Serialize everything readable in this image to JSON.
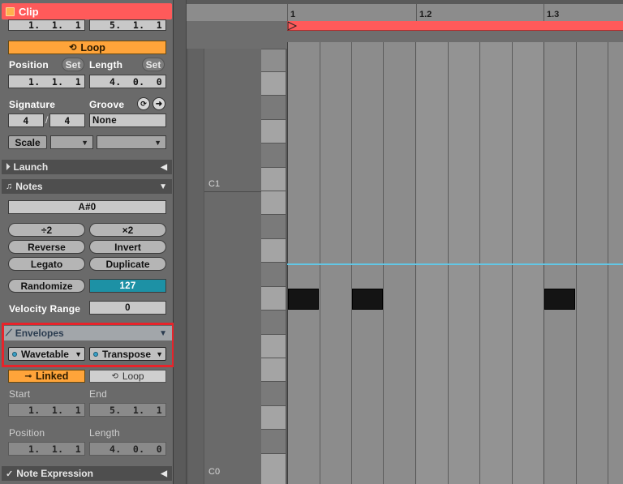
{
  "clip": {
    "title": "Clip",
    "loop_start_field": "1.  1.  1",
    "loop_end_field": "5.  1.  1",
    "loop_button": "Loop",
    "position_label": "Position",
    "set1": "Set",
    "length_label": "Length",
    "set2": "Set",
    "position_value": "1.  1.  1",
    "length_value": "4.  0.  0",
    "signature_label": "Signature",
    "groove_label": "Groove",
    "sig_num": "4",
    "sig_slash": "/",
    "sig_den": "4",
    "groove_value": "None",
    "scale_button": "Scale"
  },
  "launch": {
    "title": "Launch"
  },
  "notes": {
    "title": "Notes",
    "pitch": "A#0",
    "half": "÷2",
    "double": "×2",
    "reverse": "Reverse",
    "invert": "Invert",
    "legato": "Legato",
    "duplicate": "Duplicate",
    "randomize": "Randomize",
    "randomize_value": "127",
    "velocity_range_label": "Velocity Range",
    "velocity_range_value": "0"
  },
  "envelopes": {
    "title": "Envelopes",
    "device": "Wavetable",
    "parameter": "Transpose",
    "linked": "Linked",
    "loop": "Loop",
    "start_label": "Start",
    "end_label": "End",
    "start_value": "1.  1.  1",
    "end_value": "5.  1.  1",
    "position_label": "Position",
    "length_label": "Length",
    "position_value": "1.  1.  1",
    "length_value": "4.  0.  0"
  },
  "note_expression": {
    "title": "Note Expression"
  },
  "piano_roll": {
    "timeline_labels": [
      "1",
      "1.2",
      "1.3"
    ],
    "key_labels": [
      "C1",
      "C0"
    ]
  },
  "colors": {
    "clip_red": "#ff5a5a",
    "accent_orange": "#ffa43a",
    "teal": "#1d91a5",
    "highlight_red": "#e8232a",
    "envelope_line": "#62c7e6"
  }
}
